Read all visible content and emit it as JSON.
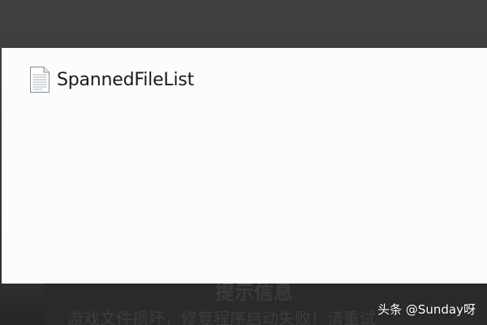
{
  "explorer": {
    "files": [
      {
        "name": "SpannedFileList",
        "icon": "text-file-icon"
      }
    ]
  },
  "background_dialog": {
    "title": "提示信息",
    "message": "游戏文件损坏，修复程序启动失败！请重试"
  },
  "watermark": {
    "text": "头条 @Sunday呀"
  },
  "colors": {
    "panel_background": "#fcfcfc",
    "desktop_background": "#3f3f3f",
    "text": "#1a1a1a"
  }
}
